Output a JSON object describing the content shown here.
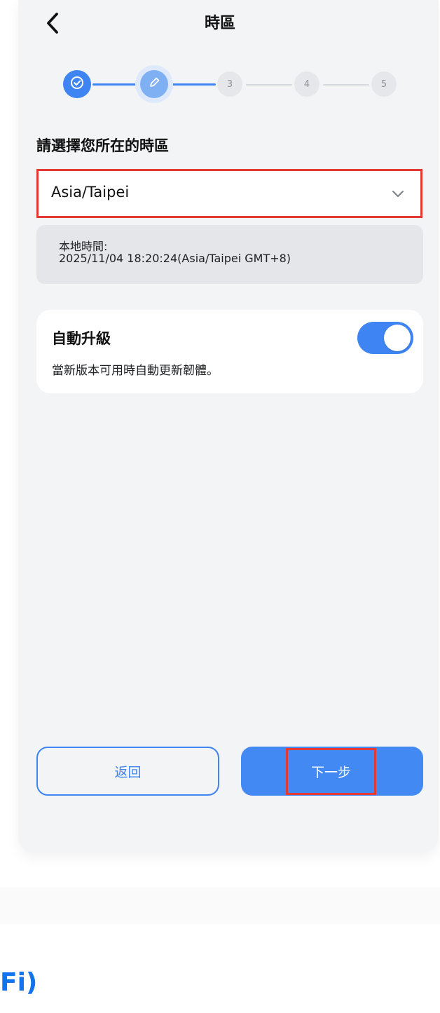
{
  "header": {
    "title": "時區"
  },
  "stepper": {
    "steps": [
      {
        "label": "",
        "state": "completed",
        "icon": "check-icon"
      },
      {
        "label": "",
        "state": "current",
        "icon": "pencil-icon"
      },
      {
        "label": "3",
        "state": "inactive"
      },
      {
        "label": "4",
        "state": "inactive"
      },
      {
        "label": "5",
        "state": "inactive"
      }
    ]
  },
  "timezone": {
    "section_label": "請選擇您所在的時區",
    "selected_value": "Asia/Taipei"
  },
  "local_time": {
    "label": "本地時間:",
    "value": "2025/11/04 18:20:24(Asia/Taipei GMT+8)"
  },
  "auto_upgrade": {
    "title": "自動升級",
    "description": "當新版本可用時自動更新韌體。",
    "enabled": true
  },
  "buttons": {
    "back_label": "返回",
    "next_label": "下一步"
  },
  "footer": {
    "partial_text": "Fi)"
  },
  "colors": {
    "primary": "#3e84f2",
    "highlight": "#e53935",
    "background": "#f3f4f5"
  }
}
